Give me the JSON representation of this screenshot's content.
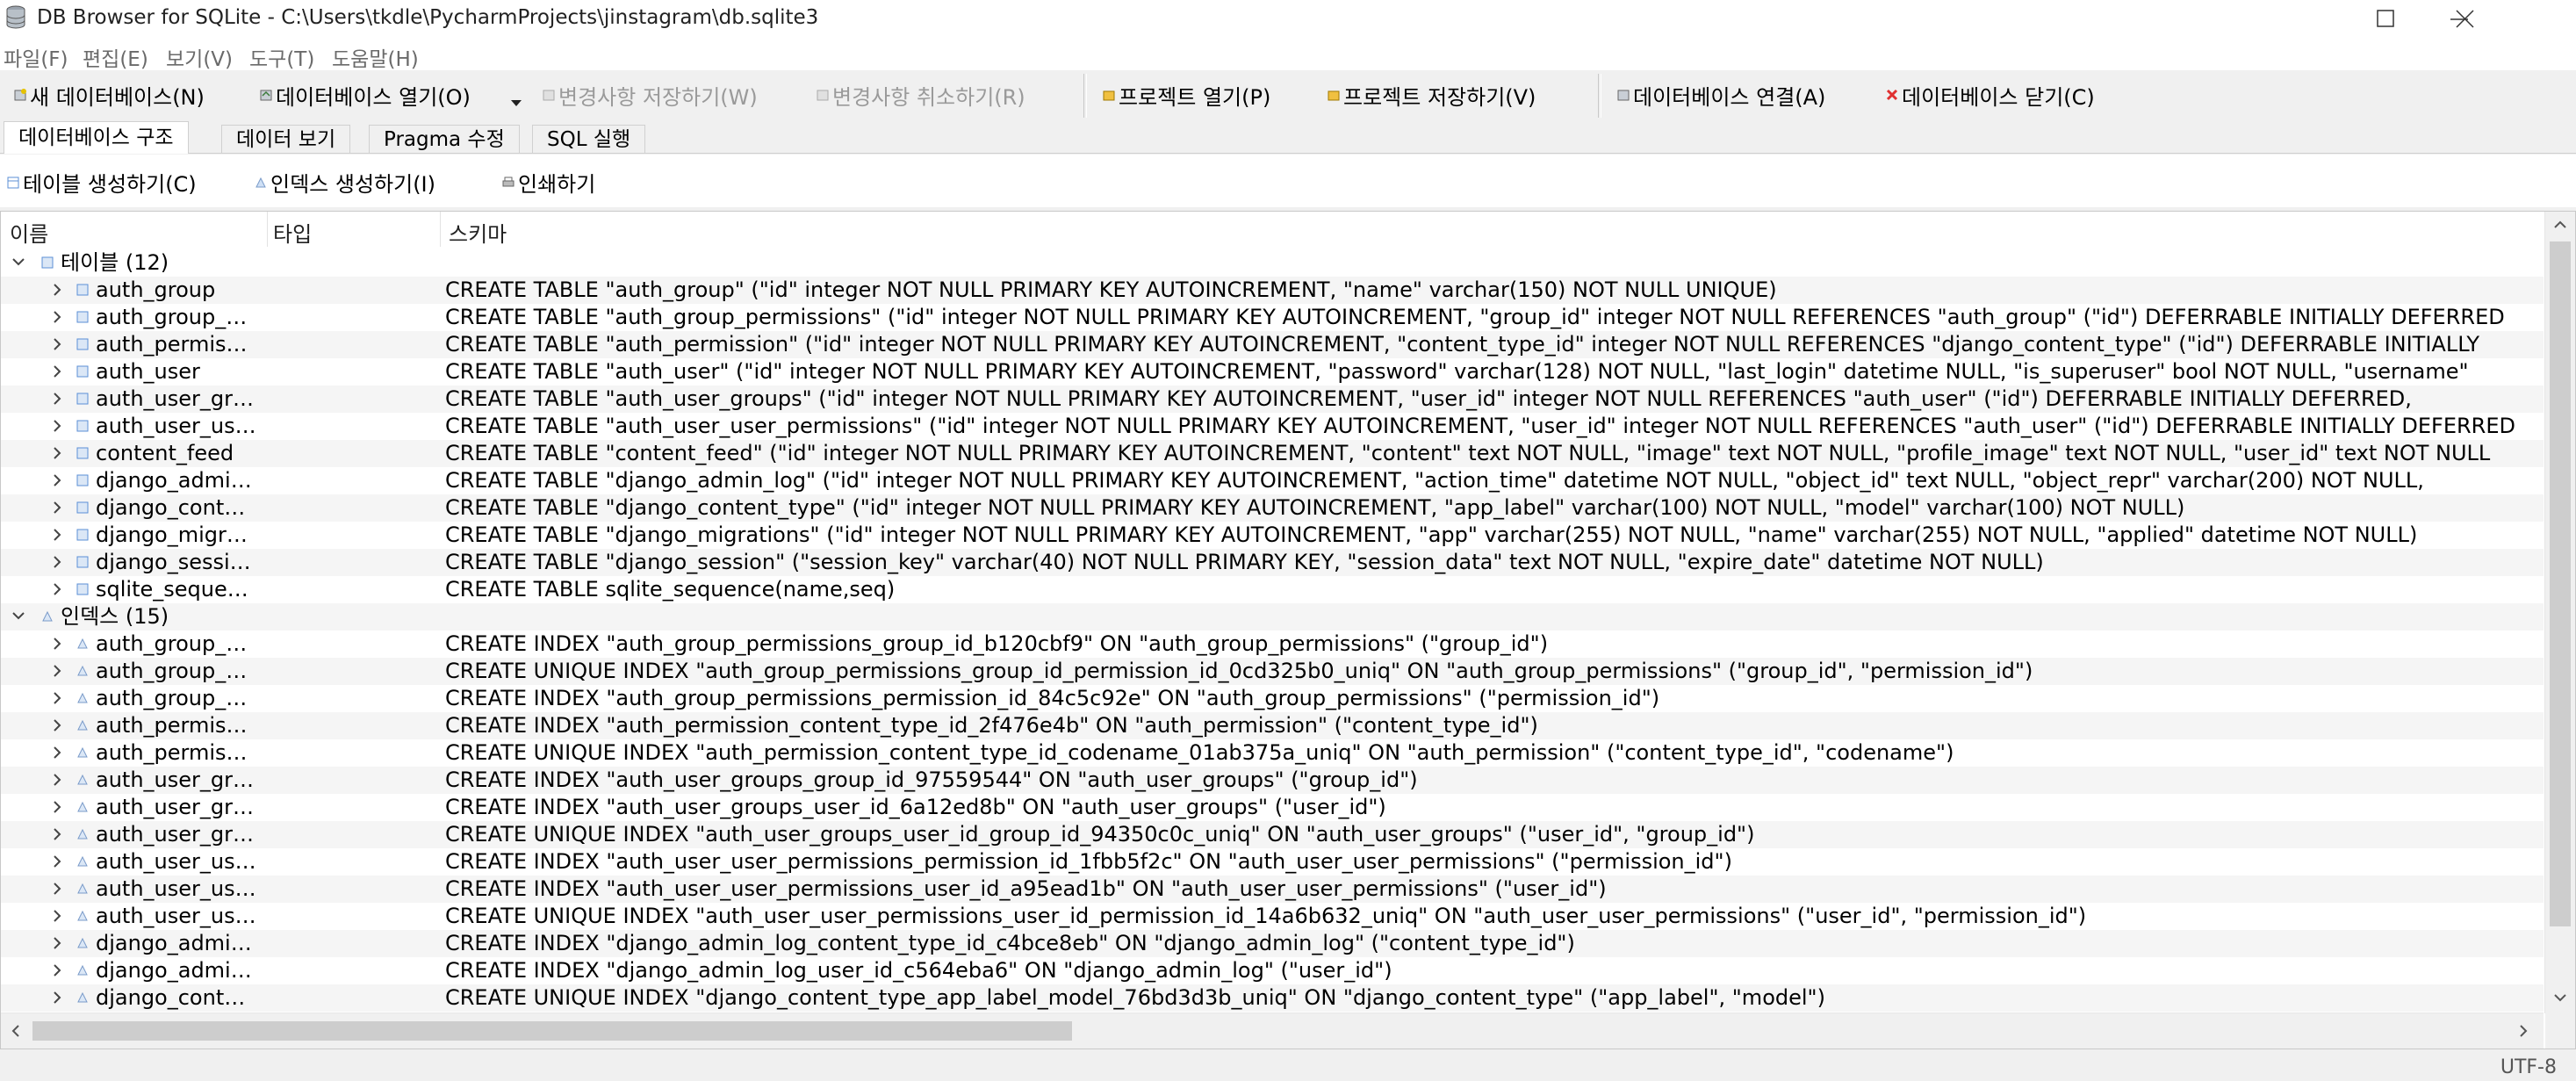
{
  "window": {
    "title": "DB Browser for SQLite - C:\\Users\\tkdle\\PycharmProjects\\jinstagram\\db.sqlite3"
  },
  "menu": [
    "파일(F)",
    "편집(E)",
    "보기(V)",
    "도구(T)",
    "도움말(H)"
  ],
  "toolbar": {
    "new_db": "새 데이터베이스(N)",
    "open_db": "데이터베이스 열기(O)",
    "write_changes": "변경사항 저장하기(W)",
    "revert_changes": "변경사항 취소하기(R)",
    "open_project": "프로젝트 열기(P)",
    "save_project": "프로젝트 저장하기(V)",
    "attach_db": "데이터베이스 연결(A)",
    "close_db": "데이터베이스 닫기(C)"
  },
  "tabs": [
    "데이터베이스 구조",
    "데이터 보기",
    "Pragma 수정",
    "SQL 실행"
  ],
  "structure_toolbar": {
    "create_table": "테이블 생성하기(C)",
    "create_index": "인덱스 생성하기(I)",
    "print": "인쇄하기"
  },
  "tree_header": {
    "name": "이름",
    "type": "타입",
    "schema": "스키마"
  },
  "tables_group": {
    "label": "테이블 (12)"
  },
  "indexes_group": {
    "label": "인덱스 (15)"
  },
  "tables": [
    {
      "name": "auth_group",
      "schema": "CREATE TABLE \"auth_group\" (\"id\" integer NOT NULL PRIMARY KEY AUTOINCREMENT, \"name\" varchar(150) NOT NULL UNIQUE)"
    },
    {
      "name": "auth_group_…",
      "schema": "CREATE TABLE \"auth_group_permissions\" (\"id\" integer NOT NULL PRIMARY KEY AUTOINCREMENT, \"group_id\" integer NOT NULL REFERENCES \"auth_group\" (\"id\") DEFERRABLE INITIALLY DEFERRED"
    },
    {
      "name": "auth_permis…",
      "schema": "CREATE TABLE \"auth_permission\" (\"id\" integer NOT NULL PRIMARY KEY AUTOINCREMENT, \"content_type_id\" integer NOT NULL REFERENCES \"django_content_type\" (\"id\") DEFERRABLE INITIALLY"
    },
    {
      "name": "auth_user",
      "schema": "CREATE TABLE \"auth_user\" (\"id\" integer NOT NULL PRIMARY KEY AUTOINCREMENT, \"password\" varchar(128) NOT NULL, \"last_login\" datetime NULL, \"is_superuser\" bool NOT NULL, \"username\""
    },
    {
      "name": "auth_user_gr…",
      "schema": "CREATE TABLE \"auth_user_groups\" (\"id\" integer NOT NULL PRIMARY KEY AUTOINCREMENT, \"user_id\" integer NOT NULL REFERENCES \"auth_user\" (\"id\") DEFERRABLE INITIALLY DEFERRED,"
    },
    {
      "name": "auth_user_us…",
      "schema": "CREATE TABLE \"auth_user_user_permissions\" (\"id\" integer NOT NULL PRIMARY KEY AUTOINCREMENT, \"user_id\" integer NOT NULL REFERENCES \"auth_user\" (\"id\") DEFERRABLE INITIALLY DEFERRED"
    },
    {
      "name": "content_feed",
      "schema": "CREATE TABLE \"content_feed\" (\"id\" integer NOT NULL PRIMARY KEY AUTOINCREMENT, \"content\" text NOT NULL, \"image\" text NOT NULL, \"profile_image\" text NOT NULL, \"user_id\" text NOT NULL"
    },
    {
      "name": "django_admi…",
      "schema": "CREATE TABLE \"django_admin_log\" (\"id\" integer NOT NULL PRIMARY KEY AUTOINCREMENT, \"action_time\" datetime NOT NULL, \"object_id\" text NULL, \"object_repr\" varchar(200) NOT NULL,"
    },
    {
      "name": "django_cont…",
      "schema": "CREATE TABLE \"django_content_type\" (\"id\" integer NOT NULL PRIMARY KEY AUTOINCREMENT, \"app_label\" varchar(100) NOT NULL, \"model\" varchar(100) NOT NULL)"
    },
    {
      "name": "django_migr…",
      "schema": "CREATE TABLE \"django_migrations\" (\"id\" integer NOT NULL PRIMARY KEY AUTOINCREMENT, \"app\" varchar(255) NOT NULL, \"name\" varchar(255) NOT NULL, \"applied\" datetime NOT NULL)"
    },
    {
      "name": "django_sessi…",
      "schema": "CREATE TABLE \"django_session\" (\"session_key\" varchar(40) NOT NULL PRIMARY KEY, \"session_data\" text NOT NULL, \"expire_date\" datetime NOT NULL)"
    },
    {
      "name": "sqlite_seque…",
      "schema": "CREATE TABLE sqlite_sequence(name,seq)"
    }
  ],
  "indexes": [
    {
      "name": "auth_group_…",
      "schema": "CREATE INDEX \"auth_group_permissions_group_id_b120cbf9\" ON \"auth_group_permissions\" (\"group_id\")"
    },
    {
      "name": "auth_group_…",
      "schema": "CREATE UNIQUE INDEX \"auth_group_permissions_group_id_permission_id_0cd325b0_uniq\" ON \"auth_group_permissions\" (\"group_id\", \"permission_id\")"
    },
    {
      "name": "auth_group_…",
      "schema": "CREATE INDEX \"auth_group_permissions_permission_id_84c5c92e\" ON \"auth_group_permissions\" (\"permission_id\")"
    },
    {
      "name": "auth_permis…",
      "schema": "CREATE INDEX \"auth_permission_content_type_id_2f476e4b\" ON \"auth_permission\" (\"content_type_id\")"
    },
    {
      "name": "auth_permis…",
      "schema": "CREATE UNIQUE INDEX \"auth_permission_content_type_id_codename_01ab375a_uniq\" ON \"auth_permission\" (\"content_type_id\", \"codename\")"
    },
    {
      "name": "auth_user_gr…",
      "schema": "CREATE INDEX \"auth_user_groups_group_id_97559544\" ON \"auth_user_groups\" (\"group_id\")"
    },
    {
      "name": "auth_user_gr…",
      "schema": "CREATE INDEX \"auth_user_groups_user_id_6a12ed8b\" ON \"auth_user_groups\" (\"user_id\")"
    },
    {
      "name": "auth_user_gr…",
      "schema": "CREATE UNIQUE INDEX \"auth_user_groups_user_id_group_id_94350c0c_uniq\" ON \"auth_user_groups\" (\"user_id\", \"group_id\")"
    },
    {
      "name": "auth_user_us…",
      "schema": "CREATE INDEX \"auth_user_user_permissions_permission_id_1fbb5f2c\" ON \"auth_user_user_permissions\" (\"permission_id\")"
    },
    {
      "name": "auth_user_us…",
      "schema": "CREATE INDEX \"auth_user_user_permissions_user_id_a95ead1b\" ON \"auth_user_user_permissions\" (\"user_id\")"
    },
    {
      "name": "auth_user_us…",
      "schema": "CREATE UNIQUE INDEX \"auth_user_user_permissions_user_id_permission_id_14a6b632_uniq\" ON \"auth_user_user_permissions\" (\"user_id\", \"permission_id\")"
    },
    {
      "name": "django_admi…",
      "schema": "CREATE INDEX \"django_admin_log_content_type_id_c4bce8eb\" ON \"django_admin_log\" (\"content_type_id\")"
    },
    {
      "name": "django_admi…",
      "schema": "CREATE INDEX \"django_admin_log_user_id_c564eba6\" ON \"django_admin_log\" (\"user_id\")"
    },
    {
      "name": "django_cont…",
      "schema": "CREATE UNIQUE INDEX \"django_content_type_app_label_model_76bd3d3b_uniq\" ON \"django_content_type\" (\"app_label\", \"model\")"
    }
  ],
  "status": {
    "encoding": "UTF-8"
  },
  "icons": {
    "table": "table-icon",
    "index": "index-icon",
    "expand": "chevron-right-icon",
    "collapse": "chevron-down-icon"
  },
  "colors": {
    "close_db_icon": "#e03030",
    "project_icon": "#d9a400",
    "table_icon": "#5b8fd6",
    "index_icon": "#7a9bc9"
  }
}
